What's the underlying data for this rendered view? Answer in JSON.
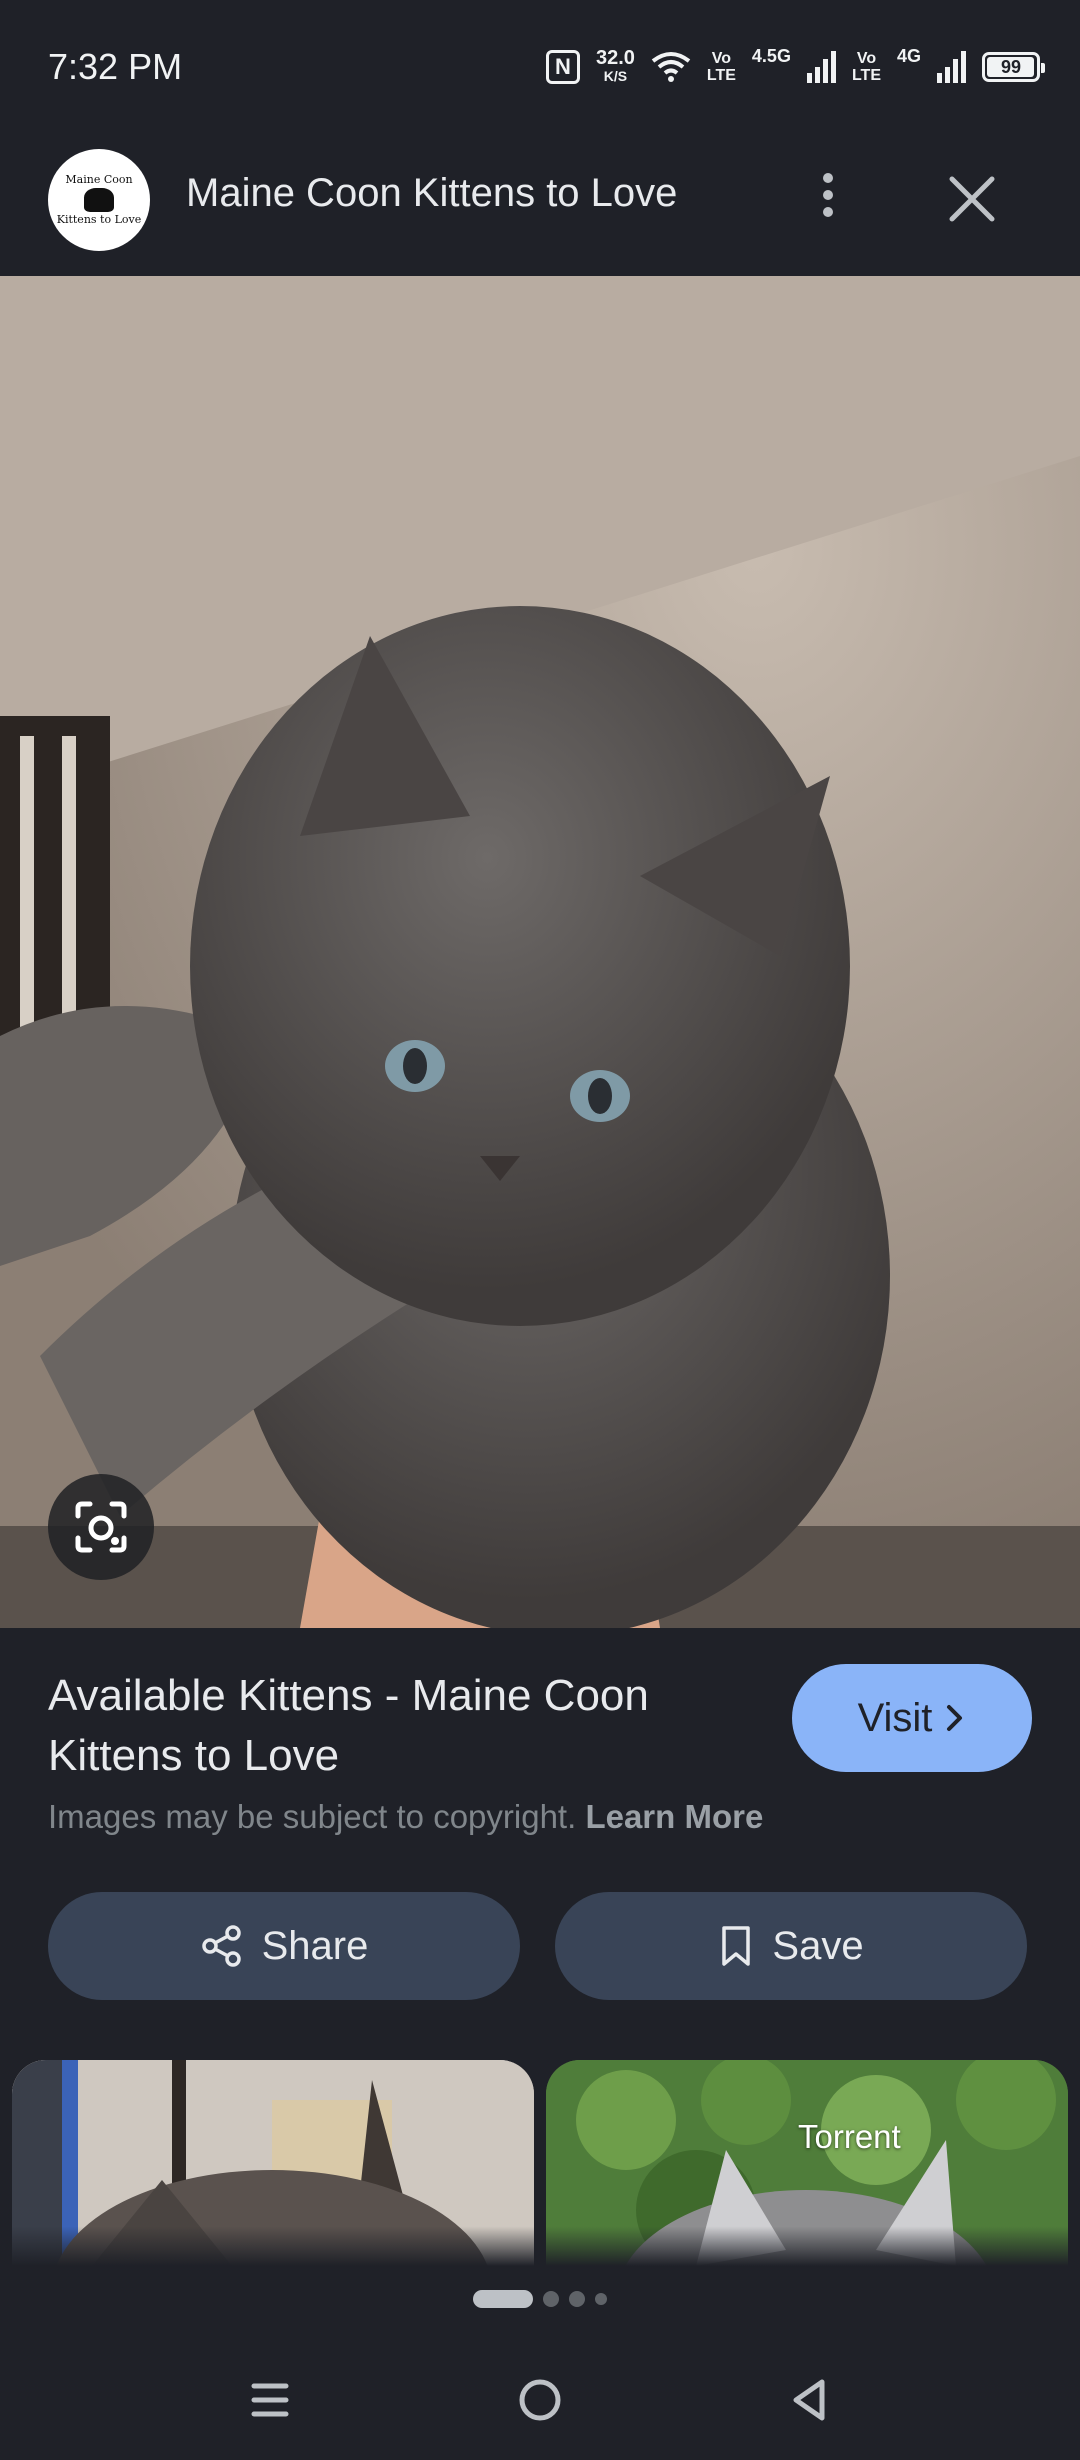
{
  "status_bar": {
    "time": "7:32 PM",
    "nfc_label": "N",
    "speed_value": "32.0",
    "speed_unit": "K/S",
    "volte1_top": "Vo",
    "volte1_bottom": "LTE",
    "net1_label": "4.5G",
    "volte2_top": "Vo",
    "volte2_bottom": "LTE",
    "net2_label": "4G",
    "battery_percent": 99,
    "battery_text": "99"
  },
  "header": {
    "site_name": "Maine Coon Kittens to Love",
    "logo_text_top": "Maine Coon",
    "logo_text_bottom": "Kittens to Love"
  },
  "result": {
    "title": "Available Kittens - Maine Coon Kittens to Love",
    "visit_label": "Visit",
    "copyright_text": "Images may be subject to copyright.",
    "learn_more_label": "Learn More"
  },
  "actions": {
    "share_label": "Share",
    "save_label": "Save"
  },
  "related": {
    "right_caption": "Torrent"
  },
  "pager": {
    "current_page": 1,
    "page_count": 4
  },
  "icons": {
    "more": "more-vert-icon",
    "close": "close-icon",
    "lens": "lens-icon",
    "chevron": "chevron-right-icon",
    "share": "share-icon",
    "bookmark": "bookmark-icon",
    "nav_menu": "recents-icon",
    "nav_home": "home-icon",
    "nav_back": "back-icon"
  },
  "colors": {
    "background": "#1f2128",
    "accent": "#8ab4f8",
    "action_button": "#394457"
  }
}
